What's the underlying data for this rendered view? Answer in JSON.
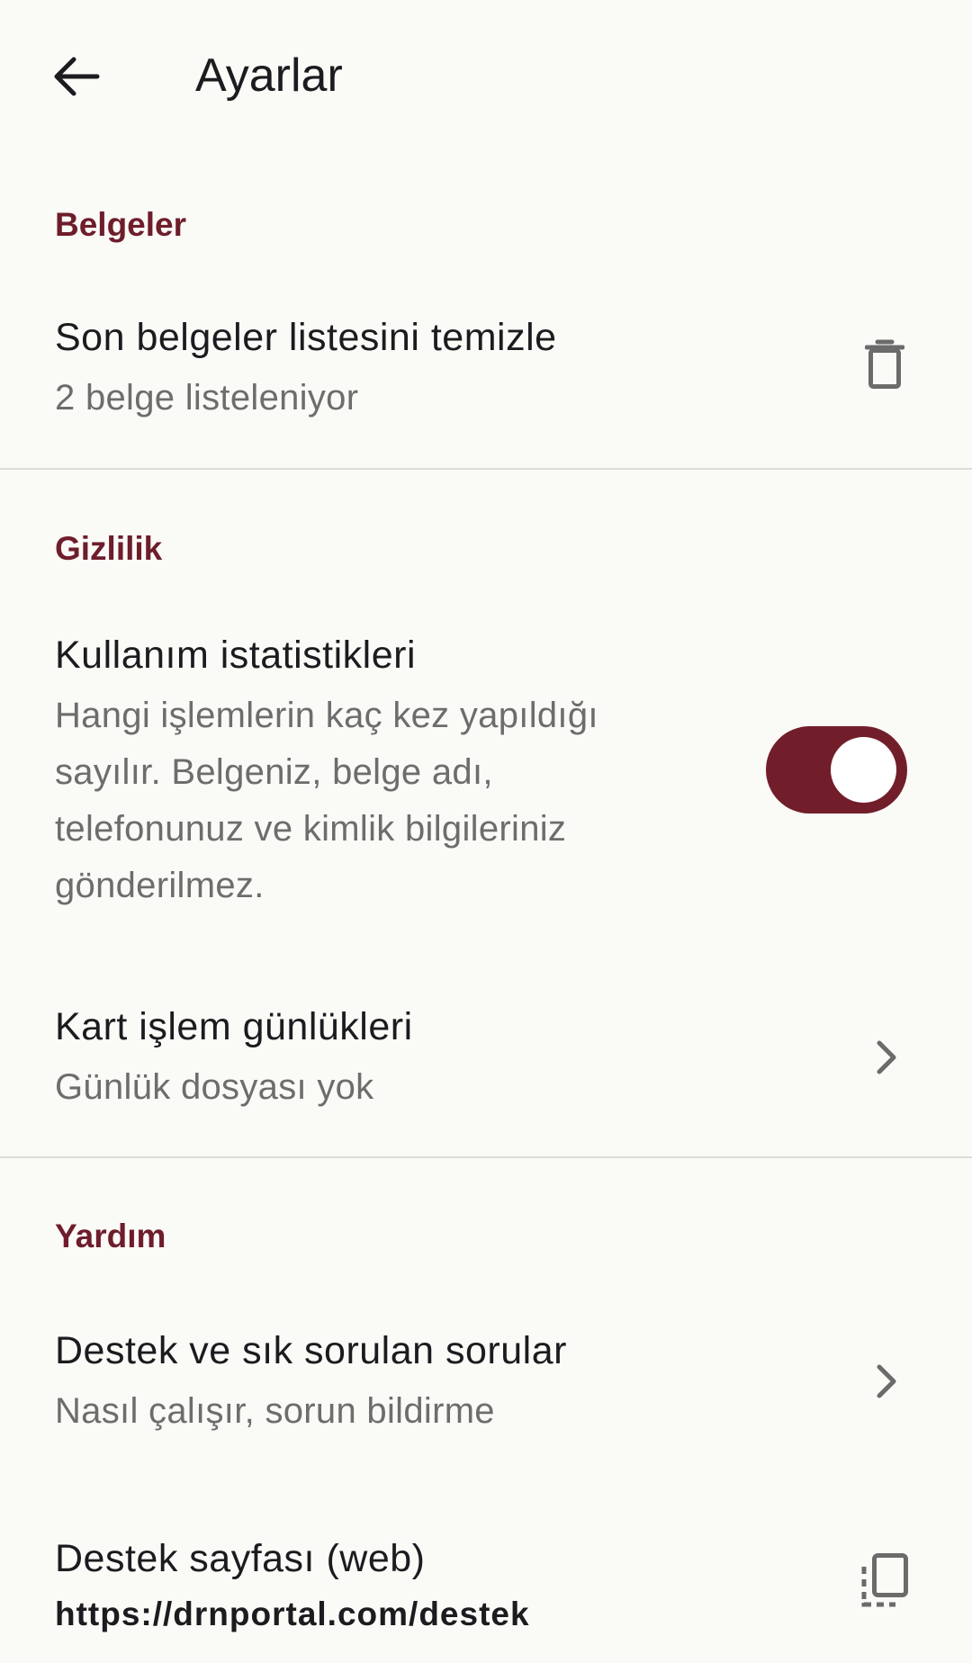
{
  "header": {
    "title": "Ayarlar",
    "back_icon": "arrow-left-icon"
  },
  "sections": {
    "documents": {
      "header": "Belgeler",
      "clear_recent": {
        "title": "Son belgeler listesini temizle",
        "subtitle": "2 belge listeleniyor",
        "icon": "trash-icon"
      }
    },
    "privacy": {
      "header": "Gizlilik",
      "usage_stats": {
        "title": "Kullanım istatistikleri",
        "subtitle_lines": [
          "Hangi işlemlerin kaç kez yapıldığı",
          "sayılır. Belgeniz, belge adı,",
          "telefonunuz ve kimlik bilgileriniz",
          "gönderilmez."
        ],
        "toggle_on": true
      },
      "card_logs": {
        "title": "Kart işlem günlükleri",
        "subtitle": "Günlük dosyası yok",
        "icon": "chevron-right-icon"
      }
    },
    "help": {
      "header": "Yardım",
      "support_faq": {
        "title": "Destek ve sık sorulan sorular",
        "subtitle": "Nasıl çalışır, sorun bildirme",
        "icon": "chevron-right-icon"
      },
      "support_page": {
        "title": "Destek sayfası (web)",
        "url": "https://drnportal.com/destek",
        "icon": "copy-icon"
      }
    }
  },
  "colors": {
    "background": "#fafaf7",
    "accent": "#6e1d2b",
    "toggle_track": "#721e2a",
    "secondary_text": "#6d6d6d",
    "icon": "#6b6b6b"
  }
}
